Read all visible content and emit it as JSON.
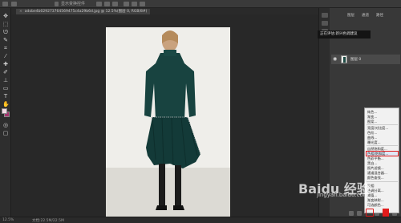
{
  "document_tab": {
    "title": "adobe4b029273764569475c4a29b6d.jpg @ 12.5%(图层 0, RGB/8#)"
  },
  "top_options": {
    "text": "显示变换控件"
  },
  "status": {
    "zoom": "12.5%",
    "doc": "文档:22.5M/22.5M"
  },
  "tooltip": {
    "text": "正在评估:新兴色调建议"
  },
  "layers_panel": {
    "tabs": [
      "图层",
      "通道",
      "路径"
    ],
    "layer_name": "图层 0"
  },
  "adjustment_menu": {
    "items": [
      "纯色...",
      "渐变...",
      "图案...",
      "亮度/对比度...",
      "色阶...",
      "曲线...",
      "曝光度...",
      "自然饱和度...",
      "色相/饱和度...",
      "色彩平衡...",
      "黑白...",
      "照片滤镜...",
      "通道混合器...",
      "颜色查找...",
      "反相",
      "色调分离...",
      "阈值...",
      "渐变映射...",
      "可选颜色..."
    ],
    "highlighted": "色相/饱和度..."
  },
  "watermark": {
    "main": "Baidu 经验",
    "sub": "jingyan.baidu.com"
  },
  "colors": {
    "foreground": "#f3dbe6",
    "background": "#a4346e",
    "highlight_border": "#e21b1b"
  }
}
